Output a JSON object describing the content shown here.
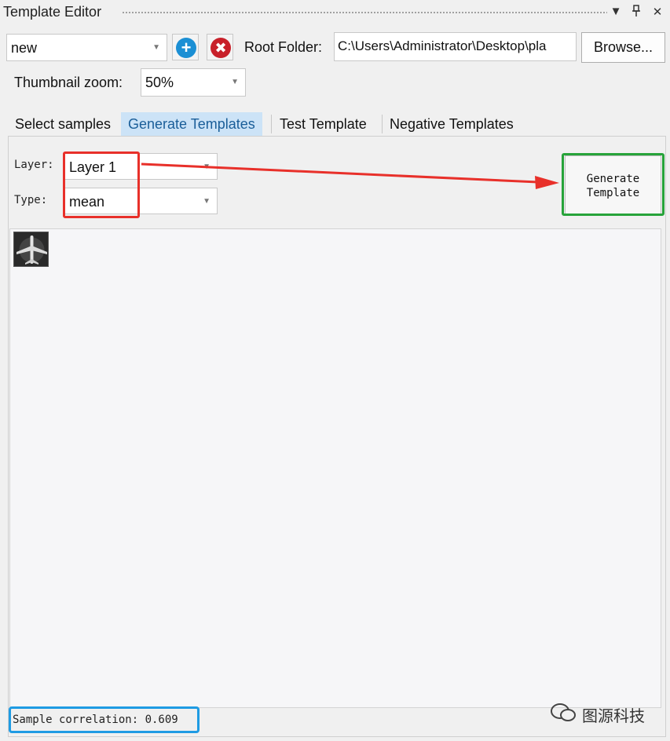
{
  "window": {
    "title": "Template Editor",
    "dropdown_icon": "dropdown-icon",
    "pin_icon": "pin-icon",
    "close_icon": "close-icon"
  },
  "toolbar": {
    "template_select_value": "new",
    "add_icon": "plus-circle-icon",
    "delete_icon": "x-circle-icon",
    "root_folder_label": "Root Folder:",
    "root_folder_value": "C:\\Users\\Administrator\\Desktop\\pla",
    "browse_label": "Browse...",
    "thumbnail_zoom_label": "Thumbnail zoom:",
    "thumbnail_zoom_value": "50%"
  },
  "tabs": [
    {
      "label": "Select samples",
      "active": false
    },
    {
      "label": "Generate Templates",
      "active": true
    },
    {
      "label": "Test Template",
      "active": false
    },
    {
      "label": "Negative Templates",
      "active": false
    }
  ],
  "generate": {
    "layer_label": "Layer:",
    "layer_value": "Layer 1",
    "type_label": "Type:",
    "type_value": "mean",
    "generate_button_line1": "Generate",
    "generate_button_line2": "Template"
  },
  "status": {
    "sample_correlation": "Sample correlation: 0.609"
  },
  "watermark": {
    "text": "图源科技"
  },
  "colors": {
    "accent_red": "#e8302a",
    "accent_green": "#27a33a",
    "accent_blue": "#1f9be3",
    "add_button": "#1b8fd4",
    "delete_button": "#c8202a",
    "active_tab_bg": "#cce3f7"
  }
}
